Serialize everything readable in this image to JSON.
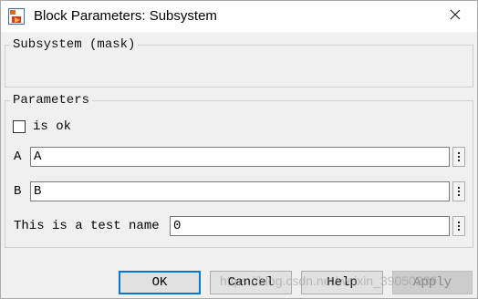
{
  "window": {
    "title": "Block Parameters: Subsystem",
    "icon": "simulink-block-icon",
    "close_icon": "close-icon"
  },
  "mask_group": {
    "legend": "Subsystem (mask)"
  },
  "parameters_group": {
    "legend": "Parameters",
    "checkbox": {
      "label": "is ok",
      "checked": false
    },
    "fields": [
      {
        "label": "A",
        "value": "A"
      },
      {
        "label": "B",
        "value": "B"
      },
      {
        "label": "This is a test name",
        "value": "0"
      }
    ]
  },
  "buttons": {
    "ok": "OK",
    "cancel": "Cancel",
    "help": "Help",
    "apply": "Apply"
  },
  "watermark": "https://blog.csdn.net/weixin_39050239",
  "colors": {
    "accent": "#0078d7",
    "dialog_bg": "#f0f0f0"
  }
}
